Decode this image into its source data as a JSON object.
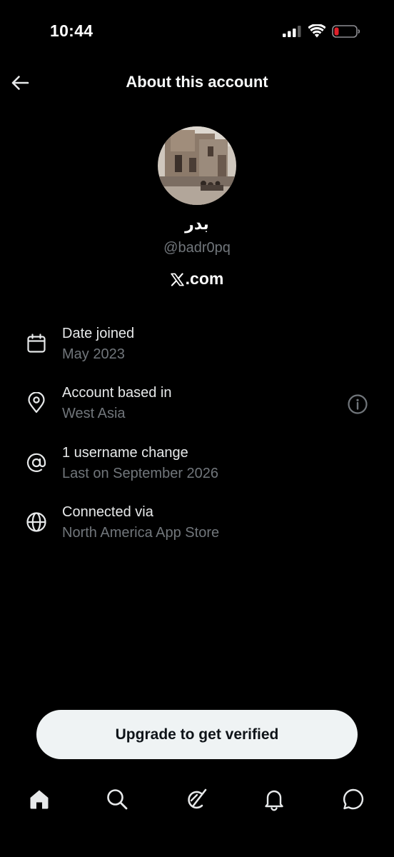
{
  "status_bar": {
    "time": "10:44",
    "battery_color": "#e0202a",
    "icons": [
      "cellular-signal-icon",
      "wifi-icon",
      "battery-low-icon"
    ]
  },
  "header": {
    "title": "About this account",
    "back_icon": "arrow-left-icon"
  },
  "profile": {
    "display_name": "بدر",
    "handle": "@badr0pq",
    "site": ".com",
    "site_logo": "x-logo-icon"
  },
  "details": [
    {
      "icon": "calendar-icon",
      "title": "Date joined",
      "value": "May 2023"
    },
    {
      "icon": "location-pin-icon",
      "title": "Account based in",
      "value": "West Asia",
      "action_icon": "info-circle-icon"
    },
    {
      "icon": "at-sign-icon",
      "title": "1 username change",
      "value": "Last on September 2026"
    },
    {
      "icon": "globe-icon",
      "title": "Connected via",
      "value": "North America App Store"
    }
  ],
  "cta": {
    "label": "Upgrade to get verified"
  },
  "bottom_nav": [
    "home-icon",
    "search-icon",
    "grok-icon",
    "notifications-bell-icon",
    "messages-icon"
  ],
  "colors": {
    "background": "#000000",
    "primary_text": "#e7e9ea",
    "secondary_text": "#71767b",
    "button_bg": "#eff3f4"
  }
}
